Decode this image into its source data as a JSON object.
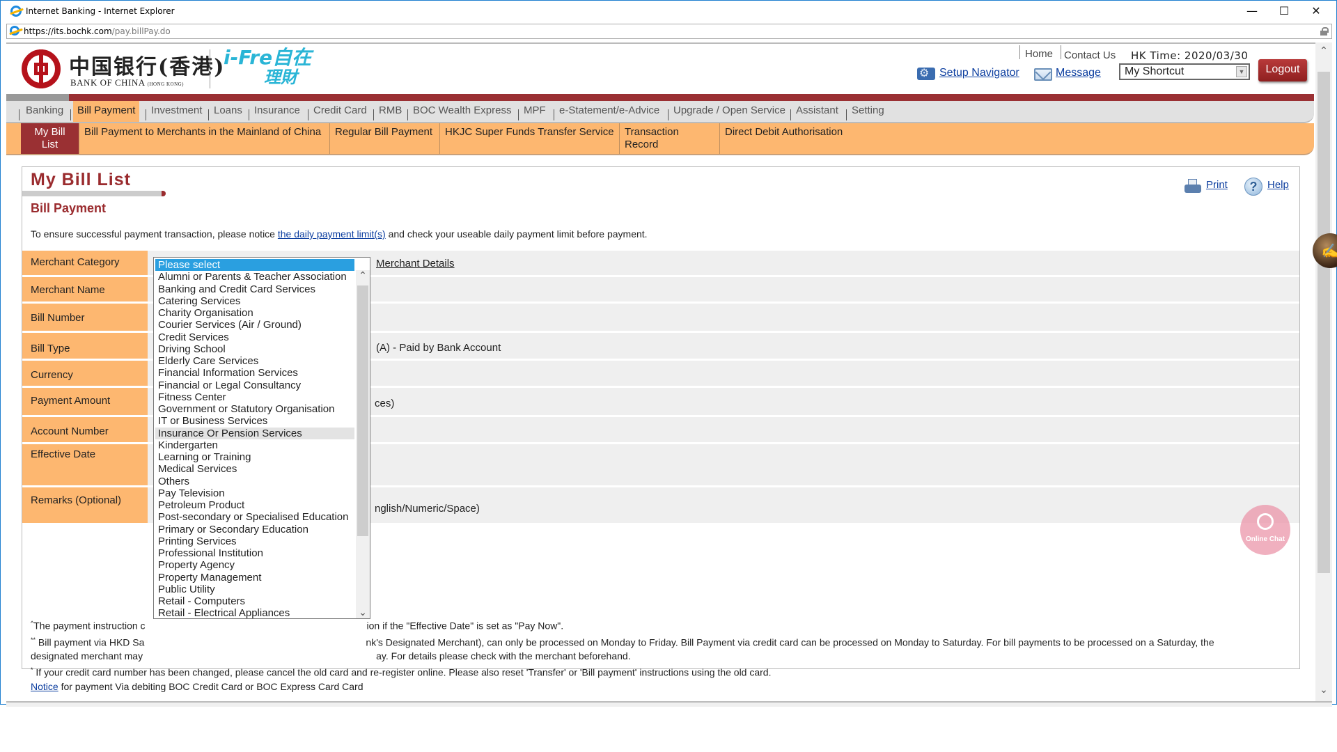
{
  "browser": {
    "window_title": "Internet Banking - Internet Explorer",
    "url_host": "https://its.bochk.com",
    "url_path": "/pay.billPay.do",
    "minimize": "—",
    "maximize": "☐",
    "close": "✕"
  },
  "header": {
    "logo_cn": "中国银行(香港)",
    "logo_en": "BANK OF CHINA",
    "logo_en_sub": "(HONG KONG)",
    "ifree_top": "i-Fre自在",
    "ifree_bottom": "理財",
    "home": "Home",
    "contact_us": "Contact Us",
    "hk_time": "HK Time: 2020/03/30",
    "setup_navigator": "Setup Navigator",
    "message": "Message",
    "shortcut_selected": "My Shortcut",
    "logout": "Logout"
  },
  "main_nav": {
    "items": [
      "Banking",
      "Bill Payment",
      "Investment",
      "Loans",
      "Insurance",
      "Credit Card",
      "RMB",
      "BOC Wealth Express",
      "MPF",
      "e-Statement/e-Advice",
      "Upgrade / Open Service",
      "Assistant",
      "Setting"
    ],
    "active": "Bill Payment"
  },
  "sub_nav": {
    "items": [
      "My Bill List",
      "Bill Payment to Merchants in the Mainland of China",
      "Regular Bill Payment",
      "HKJC Super Funds Transfer Service",
      "Transaction Record",
      "Direct Debit Authorisation"
    ],
    "active": "My Bill List"
  },
  "page": {
    "title": "My Bill List",
    "section_title": "Bill Payment",
    "notice_before": "To ensure successful payment transaction, please notice ",
    "notice_link": "the daily payment limit(s)",
    "notice_after": " and check your useable daily payment limit before payment.",
    "print": "Print",
    "help": "Help"
  },
  "form": {
    "rows": [
      {
        "label": "Merchant Category",
        "value": "Merchant Details"
      },
      {
        "label": "Merchant Name",
        "value": ""
      },
      {
        "label": "Bill Number",
        "value": ""
      },
      {
        "label": "Bill Type",
        "value": "(A) - Paid by Bank Account"
      },
      {
        "label": "Currency",
        "value": ""
      },
      {
        "label": "Payment Amount",
        "value": "ces)"
      },
      {
        "label": "Account Number",
        "value": ""
      },
      {
        "label": "Effective Date",
        "value": ""
      },
      {
        "label": "Remarks (Optional)",
        "value": "nglish/Numeric/Space)"
      }
    ]
  },
  "merchant_category_dropdown": {
    "selected": "Please select",
    "hovered": "Insurance Or Pension Services",
    "options": [
      "Please select",
      "Alumni or Parents & Teacher Association",
      "Banking and Credit Card Services",
      "Catering Services",
      "Charity Organisation",
      "Courier Services (Air / Ground)",
      "Credit Services",
      "Driving School",
      "Elderly Care Services",
      "Financial Information Services",
      "Financial or Legal Consultancy",
      "Fitness Center",
      "Government or Statutory Organisation",
      "IT or Business Services",
      "Insurance Or Pension Services",
      "Kindergarten",
      "Learning or Training",
      "Medical Services",
      "Others",
      "Pay Television",
      "Petroleum Product",
      "Post-secondary or Specialised Education",
      "Primary or Secondary Education",
      "Printing Services",
      "Professional Institution",
      "Property Agency",
      "Property Management",
      "Public Utility",
      "Retail - Computers",
      "Retail - Electrical Appliances"
    ]
  },
  "footnotes": {
    "line1_mark": "^",
    "line1_a": "The payment instruction c",
    "line1_b": "ion if the \"Effective Date\" is set as \"Pay Now\".",
    "line2_mark": "**",
    "line2_a": " Bill payment via HKD Sa",
    "line2_b": "nk's Designated Merchant), can only be processed on Monday to Friday. Bill Payment via credit card can be processed on Monday to Saturday. For bill payments to be processed on a Saturday, the",
    "line3_a": "designated merchant may",
    "line3_b": "ay. For details please check with the merchant beforehand.",
    "line4_mark": "*",
    "line4": " If your credit card number has been changed, please cancel the old card and re-register online. Please also reset 'Transfer' or 'Bill payment' instructions using the old card.",
    "line5_link": "Notice",
    "line5": " for payment Via debiting BOC Credit Card or BOC Express Card Card"
  },
  "online_chat": "Online Chat",
  "colors": {
    "brand_red": "#9a3033",
    "nav_orange": "#fdb770",
    "link_blue": "#0b3d9f",
    "select_blue": "#2a9fe0"
  }
}
